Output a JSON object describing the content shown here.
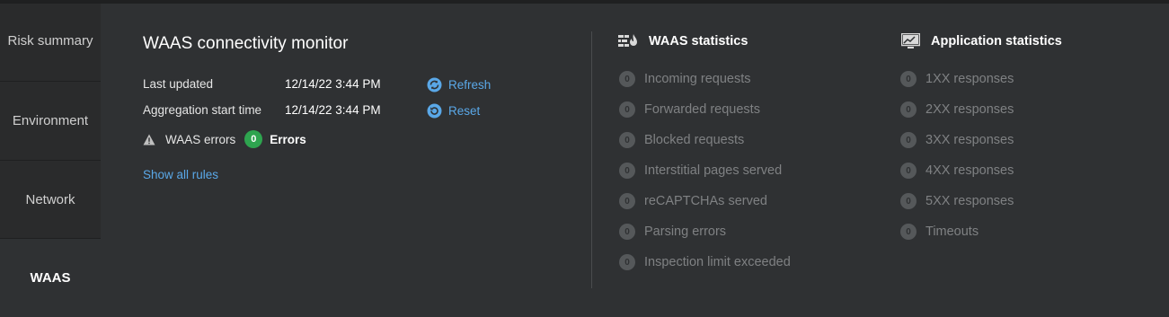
{
  "sidebar": {
    "items": [
      {
        "label": "Risk summary"
      },
      {
        "label": "Environment"
      },
      {
        "label": "Network"
      },
      {
        "label": "WAAS"
      }
    ]
  },
  "monitor": {
    "title": "WAAS connectivity monitor",
    "last_updated_label": "Last updated",
    "last_updated_value": "12/14/22 3:44 PM",
    "aggregation_label": "Aggregation start time",
    "aggregation_value": "12/14/22 3:44 PM",
    "refresh_label": "Refresh",
    "reset_label": "Reset",
    "errors_label": "WAAS errors",
    "errors_count": "0",
    "errors_suffix": "Errors",
    "show_rules_label": "Show all rules"
  },
  "waas_stats": {
    "title": "WAAS statistics",
    "items": [
      {
        "count": "0",
        "label": "Incoming requests"
      },
      {
        "count": "0",
        "label": "Forwarded requests"
      },
      {
        "count": "0",
        "label": "Blocked requests"
      },
      {
        "count": "0",
        "label": "Interstitial pages served"
      },
      {
        "count": "0",
        "label": "reCAPTCHAs served"
      },
      {
        "count": "0",
        "label": "Parsing errors"
      },
      {
        "count": "0",
        "label": "Inspection limit exceeded"
      }
    ]
  },
  "app_stats": {
    "title": "Application statistics",
    "items": [
      {
        "count": "0",
        "label": "1XX responses"
      },
      {
        "count": "0",
        "label": "2XX responses"
      },
      {
        "count": "0",
        "label": "3XX responses"
      },
      {
        "count": "0",
        "label": "4XX responses"
      },
      {
        "count": "0",
        "label": "5XX responses"
      },
      {
        "count": "0",
        "label": "Timeouts"
      }
    ]
  },
  "colors": {
    "background": "#2f3133",
    "sidebar": "#2a2b2c",
    "link": "#5aa8e8",
    "success": "#2ea44f",
    "muted": "#7f8183"
  }
}
